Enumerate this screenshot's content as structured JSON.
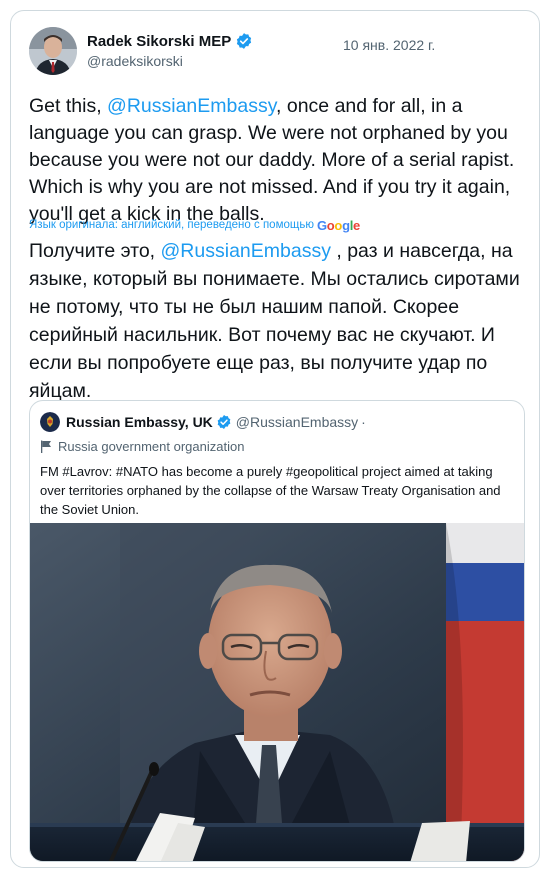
{
  "tweet": {
    "author_name": "Radek Sikorski MEP",
    "author_handle": "@radeksikorski",
    "date": "10 янв. 2022 г.",
    "text_prefix": "Get this, ",
    "mention": "@RussianEmbassy",
    "text_suffix": ", once and for all, in a language you can grasp. We were not orphaned by you because you were not our daddy. More of a serial rapist. Which is why you are not missed. And if you try it again, you'll get a kick in the balls.",
    "translation_note": "Язык оригинала: английский, переведено с помощью",
    "google_logo": [
      "G",
      "o",
      "o",
      "g",
      "l",
      "e"
    ],
    "translated_prefix": "Получите это, ",
    "translated_mention": "@RussianEmbassy",
    "translated_suffix": " , раз и навсегда, на языке, который вы понимаете. Мы остались сиротами не потому, что ты не был нашим папой. Скорее серийный насильник. Вот почему вас не скучают. И если вы попробуете еще раз, вы получите удар по яйцам."
  },
  "quoted_tweet": {
    "author_name": "Russian Embassy, UK",
    "author_handle": "@RussianEmbassy",
    "dot": "·",
    "label": "Russia government organization",
    "text": "FM #Lavrov: #NATO has become a purely #geopolitical project aimed at taking over territories orphaned by the collapse of the Warsaw Treaty Organisation and the Soviet Union."
  },
  "colors": {
    "accent": "#1d9bf0",
    "text": "#0f1419",
    "secondary": "#536471",
    "border": "#cfd9de"
  },
  "icons": {
    "verified": "verified-badge-icon",
    "flag": "flag-icon",
    "emblem": "emblem-icon"
  }
}
